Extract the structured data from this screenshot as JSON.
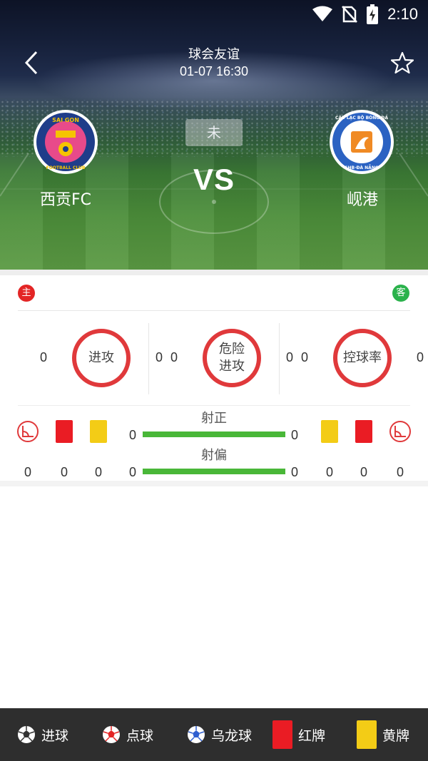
{
  "status_bar": {
    "time": "2:10"
  },
  "header": {
    "title": "球会友谊",
    "datetime": "01-07 16:30"
  },
  "match": {
    "state": "未",
    "vs": "VS",
    "home": {
      "name": "西贡FC"
    },
    "away": {
      "name": "岘港"
    },
    "home_logo_text": [
      "SAI GON",
      "FOOTBALL CLUB"
    ],
    "away_logo_text": [
      "CÂU LẠC BỘ BÓNG ĐÁ",
      "SHB·ĐÀ NẴNG"
    ]
  },
  "tags": {
    "home": "主",
    "away": "客"
  },
  "stats": {
    "circles": [
      {
        "label_lines": [
          "进攻"
        ],
        "home": "0",
        "away": "0"
      },
      {
        "label_lines": [
          "危险",
          "进攻"
        ],
        "home": "0",
        "away": "0"
      },
      {
        "label_lines": [
          "控球率"
        ],
        "home": "0",
        "away": "0"
      }
    ],
    "bars": [
      {
        "label": "射正",
        "home": "0",
        "away": "0",
        "home_share": 0.5
      },
      {
        "label": "射偏",
        "home": "0",
        "away": "0",
        "home_share": 0.5
      }
    ],
    "home_counts": [
      "0",
      "0",
      "0"
    ],
    "away_counts": [
      "0",
      "0",
      "0"
    ]
  },
  "colors": {
    "ring": "#e0393b",
    "bar": "#49b738",
    "red_card": "#ea1c24",
    "yellow_card": "#f3cc16",
    "home_tag": "#e32525",
    "away_tag": "#2bb24c"
  },
  "legend": [
    {
      "icon": "soccer-ball-icon",
      "label": "进球"
    },
    {
      "icon": "penalty-ball-icon",
      "label": "点球"
    },
    {
      "icon": "own-goal-ball-icon",
      "label": "乌龙球"
    },
    {
      "icon": "red-card-icon",
      "label": "红牌"
    },
    {
      "icon": "yellow-card-icon",
      "label": "黄牌"
    }
  ]
}
